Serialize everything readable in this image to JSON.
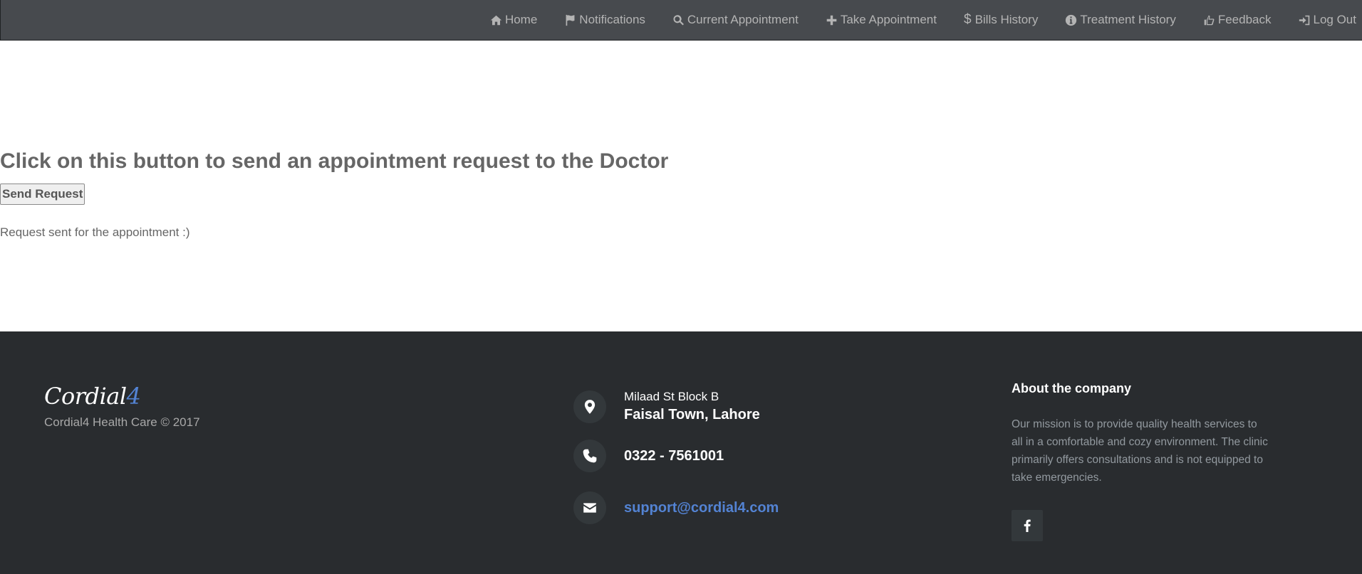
{
  "nav": {
    "items": [
      {
        "label": "Home",
        "icon": "home-icon"
      },
      {
        "label": "Notifications",
        "icon": "flag-icon"
      },
      {
        "label": "Current Appointment",
        "icon": "search-icon"
      },
      {
        "label": "Take Appointment",
        "icon": "plus-icon"
      },
      {
        "label": "Bills History",
        "icon": "dollar-icon"
      },
      {
        "label": "Treatment History",
        "icon": "info-icon"
      },
      {
        "label": "Feedback",
        "icon": "thumbs-up-icon"
      },
      {
        "label": "Log Out",
        "icon": "log-out-icon"
      }
    ]
  },
  "main": {
    "headline": "Click on this button to send an appointment request to the Doctor",
    "button_label": "Send Request",
    "status": "Request sent for the appointment :)"
  },
  "footer": {
    "logo_main": "Cordial",
    "logo_accent": "4",
    "copyright": "Cordial4 Health Care © 2017",
    "address_line1": "Milaad St Block B",
    "address_line2": "Faisal Town, Lahore",
    "phone": "0322 - 7561001",
    "email": "support@cordial4.com",
    "about_title": "About the company",
    "about_text": "Our mission is to provide quality health services to all in a comfortable and cozy environment. The clinic primarily offers consultations and is not equipped to take emergencies."
  },
  "colors": {
    "navbar_bg": "#474a4e",
    "footer_bg": "#292c2f",
    "accent": "#5383d3"
  }
}
